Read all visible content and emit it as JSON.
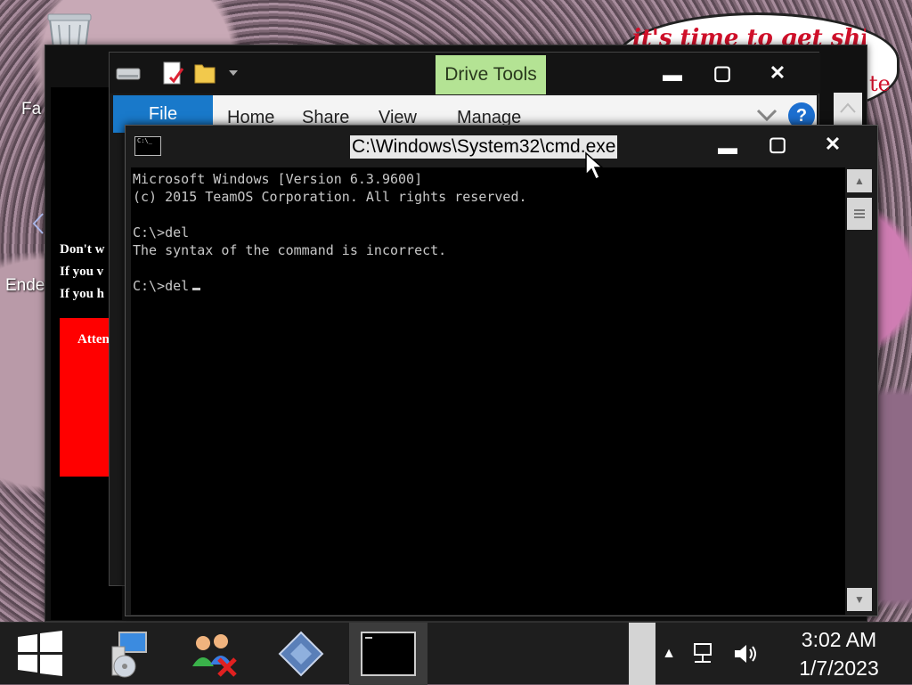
{
  "desktop": {
    "wallpaper_text": "it's time to get shit",
    "wallpaper_text_2": "te",
    "icon_labels": [
      "Fa",
      "Ende"
    ],
    "warning_lines": [
      "Don't w",
      "If you v",
      "If you h"
    ],
    "red_panel_text": "Atten"
  },
  "explorer": {
    "contextual_tab": "Drive Tools",
    "ribbon_tabs": [
      "File",
      "Home",
      "Share",
      "View",
      "Manage"
    ],
    "help_label": "?"
  },
  "cmd": {
    "title": "C:\\Windows\\System32\\cmd.exe",
    "icon_text": "C:\\_",
    "lines": [
      "Microsoft Windows [Version 6.3.9600]",
      "(c) 2015 TeamOS Corporation. All rights reserved.",
      "",
      "C:\\>del",
      "The syntax of the command is incorrect.",
      "",
      "C:\\>del"
    ]
  },
  "taskbar": {
    "time": "3:02 AM",
    "date": "1/7/2023",
    "items": [
      "network-setup-icon",
      "users-error-icon",
      "installer-icon",
      "cmd-task-icon"
    ]
  },
  "colors": {
    "drive_tools_bg": "#b4e394",
    "file_tab_bg": "#1979ca",
    "console_bg": "#000000",
    "console_text": "#c8c8c8",
    "warning_red": "#ff0000"
  }
}
